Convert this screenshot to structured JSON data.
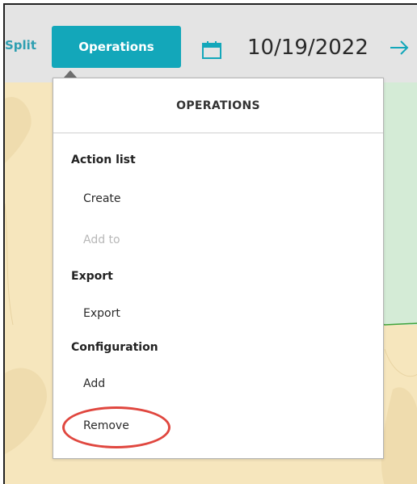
{
  "toolbar": {
    "split_label": "Split",
    "operations_label": "Operations",
    "date_value": "10/19/2022",
    "calendar_icon": "calendar-icon",
    "next_icon": "arrow-right-icon",
    "accent_color": "#13a7ba"
  },
  "menu": {
    "title": "OPERATIONS",
    "sections": [
      {
        "label": "Action list",
        "items": [
          {
            "label": "Create",
            "enabled": true
          },
          {
            "label": "Add to",
            "enabled": false
          }
        ]
      },
      {
        "label": "Export",
        "items": [
          {
            "label": "Export",
            "enabled": true
          }
        ]
      },
      {
        "label": "Configuration",
        "items": [
          {
            "label": "Add",
            "enabled": true
          },
          {
            "label": "Remove",
            "enabled": true
          }
        ]
      }
    ],
    "highlight_color": "#e0473f"
  }
}
